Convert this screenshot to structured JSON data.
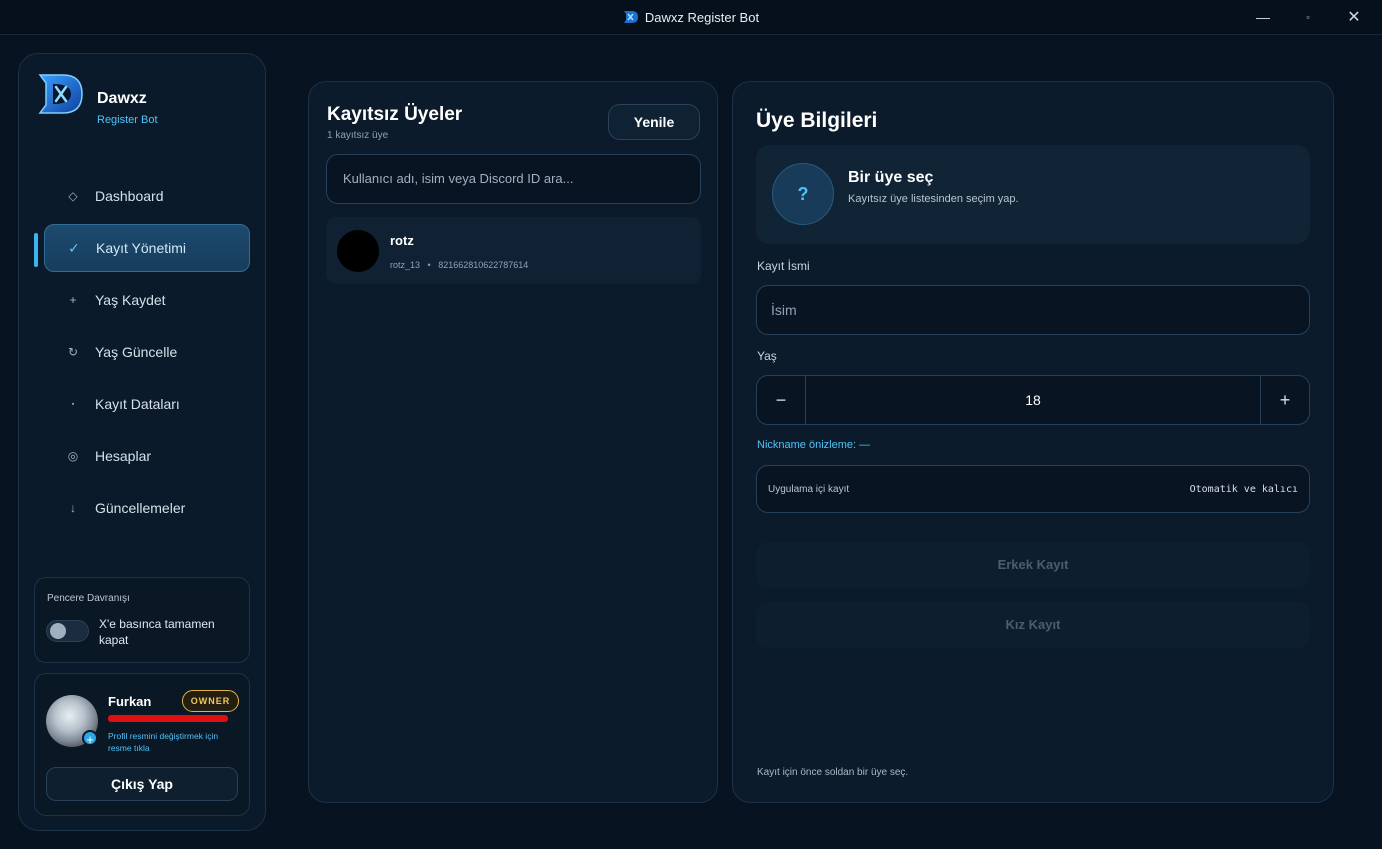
{
  "window": {
    "title": "Dawxz Register Bot",
    "controls": {
      "minimize": "—",
      "maximize": "▫",
      "close": "✕"
    }
  },
  "brand": {
    "name": "Dawxz",
    "subtitle": "Register Bot"
  },
  "sidebar": {
    "items": [
      {
        "label": "Dashboard",
        "icon": "diamond-icon",
        "glyph": "◇",
        "active": false
      },
      {
        "label": "Kayıt Yönetimi",
        "icon": "check-icon",
        "glyph": "✓",
        "active": true
      },
      {
        "label": "Yaş Kaydet",
        "icon": "plus-icon",
        "glyph": "+",
        "active": false
      },
      {
        "label": "Yaş Güncelle",
        "icon": "refresh-icon",
        "glyph": "↻",
        "active": false
      },
      {
        "label": "Kayıt Dataları",
        "icon": "dot-icon",
        "glyph": "▪",
        "active": false
      },
      {
        "label": "Hesaplar",
        "icon": "target-icon",
        "glyph": "◎",
        "active": false
      },
      {
        "label": "Güncellemeler",
        "icon": "arrow-down-icon",
        "glyph": "↓",
        "active": false
      }
    ],
    "window_behavior": {
      "title": "Pencere Davranışı",
      "toggle_label": "X'e basınca tamamen kapat",
      "toggle_on": false
    },
    "profile": {
      "name": "Furkan",
      "badge": "OWNER",
      "hint": "Profil resmini değiştirmek için resme tıkla",
      "logout_label": "Çıkış Yap"
    }
  },
  "members": {
    "title": "Kayıtsız Üyeler",
    "count_text": "1 kayıtsız üye",
    "refresh_label": "Yenile",
    "search_placeholder": "Kullanıcı adı, isim veya Discord ID ara...",
    "list": [
      {
        "name": "rotz",
        "username": "rotz_13",
        "separator": "•",
        "id": "821662810622787614"
      }
    ]
  },
  "details": {
    "title": "Üye Bilgileri",
    "select_icon": "?",
    "select_title": "Bir üye seç",
    "select_subtitle": "Kayıtsız üye listesinden seçim yap.",
    "name_label": "Kayıt İsmi",
    "name_placeholder": "İsim",
    "age_label": "Yaş",
    "age_value": "18",
    "age_minus": "−",
    "age_plus": "+",
    "nickname_preview": "Nickname önizleme: —",
    "app_register_label": "Uygulama içi kayıt",
    "app_register_value": "Otomatik ve kalıcı",
    "male_button": "Erkek Kayıt",
    "female_button": "Kız Kayıt",
    "footer_hint": "Kayıt için önce soldan bir üye seç."
  },
  "colors": {
    "accent": "#4fc3f7",
    "background": "#071320",
    "panel": "#0c1b2b",
    "owner_badge": "#f0c860"
  }
}
